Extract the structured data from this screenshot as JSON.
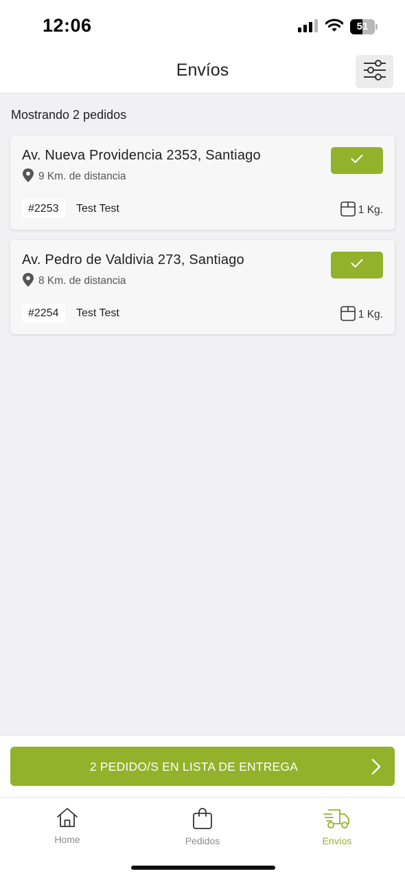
{
  "status_bar": {
    "time": "12:06",
    "battery_level": "51",
    "battery_fraction": 0.51,
    "icons": [
      "cellular-signal-icon",
      "wifi-icon",
      "battery-icon"
    ]
  },
  "header": {
    "title": "Envíos",
    "filter_icon": "sliders-icon"
  },
  "content": {
    "showing_count": "Mostrando 2 pedidos",
    "orders": [
      {
        "address": "Av. Nueva Providencia 2353, Santiago",
        "distance": "9 Km. de distancia",
        "id": "#2253",
        "customer": "Test Test",
        "weight": "1 Kg."
      },
      {
        "address": "Av. Pedro de Valdivia 273, Santiago",
        "distance": "8 Km. de distancia",
        "id": "#2254",
        "customer": "Test Test",
        "weight": "1 Kg."
      }
    ]
  },
  "action": {
    "delivery_list_label": "2 PEDIDO/S EN LISTA DE ENTREGA"
  },
  "tabs": [
    {
      "label": "Home",
      "icon": "home-icon",
      "active": false
    },
    {
      "label": "Pedidos",
      "icon": "shopping-bag-icon",
      "active": false
    },
    {
      "label": "Envíos",
      "icon": "delivery-truck-icon",
      "active": true
    }
  ],
  "colors": {
    "accent": "#91b22a",
    "background": "#f1f1f3",
    "card": "#f7f7f7",
    "inactive_tab": "#8a8a8a"
  }
}
